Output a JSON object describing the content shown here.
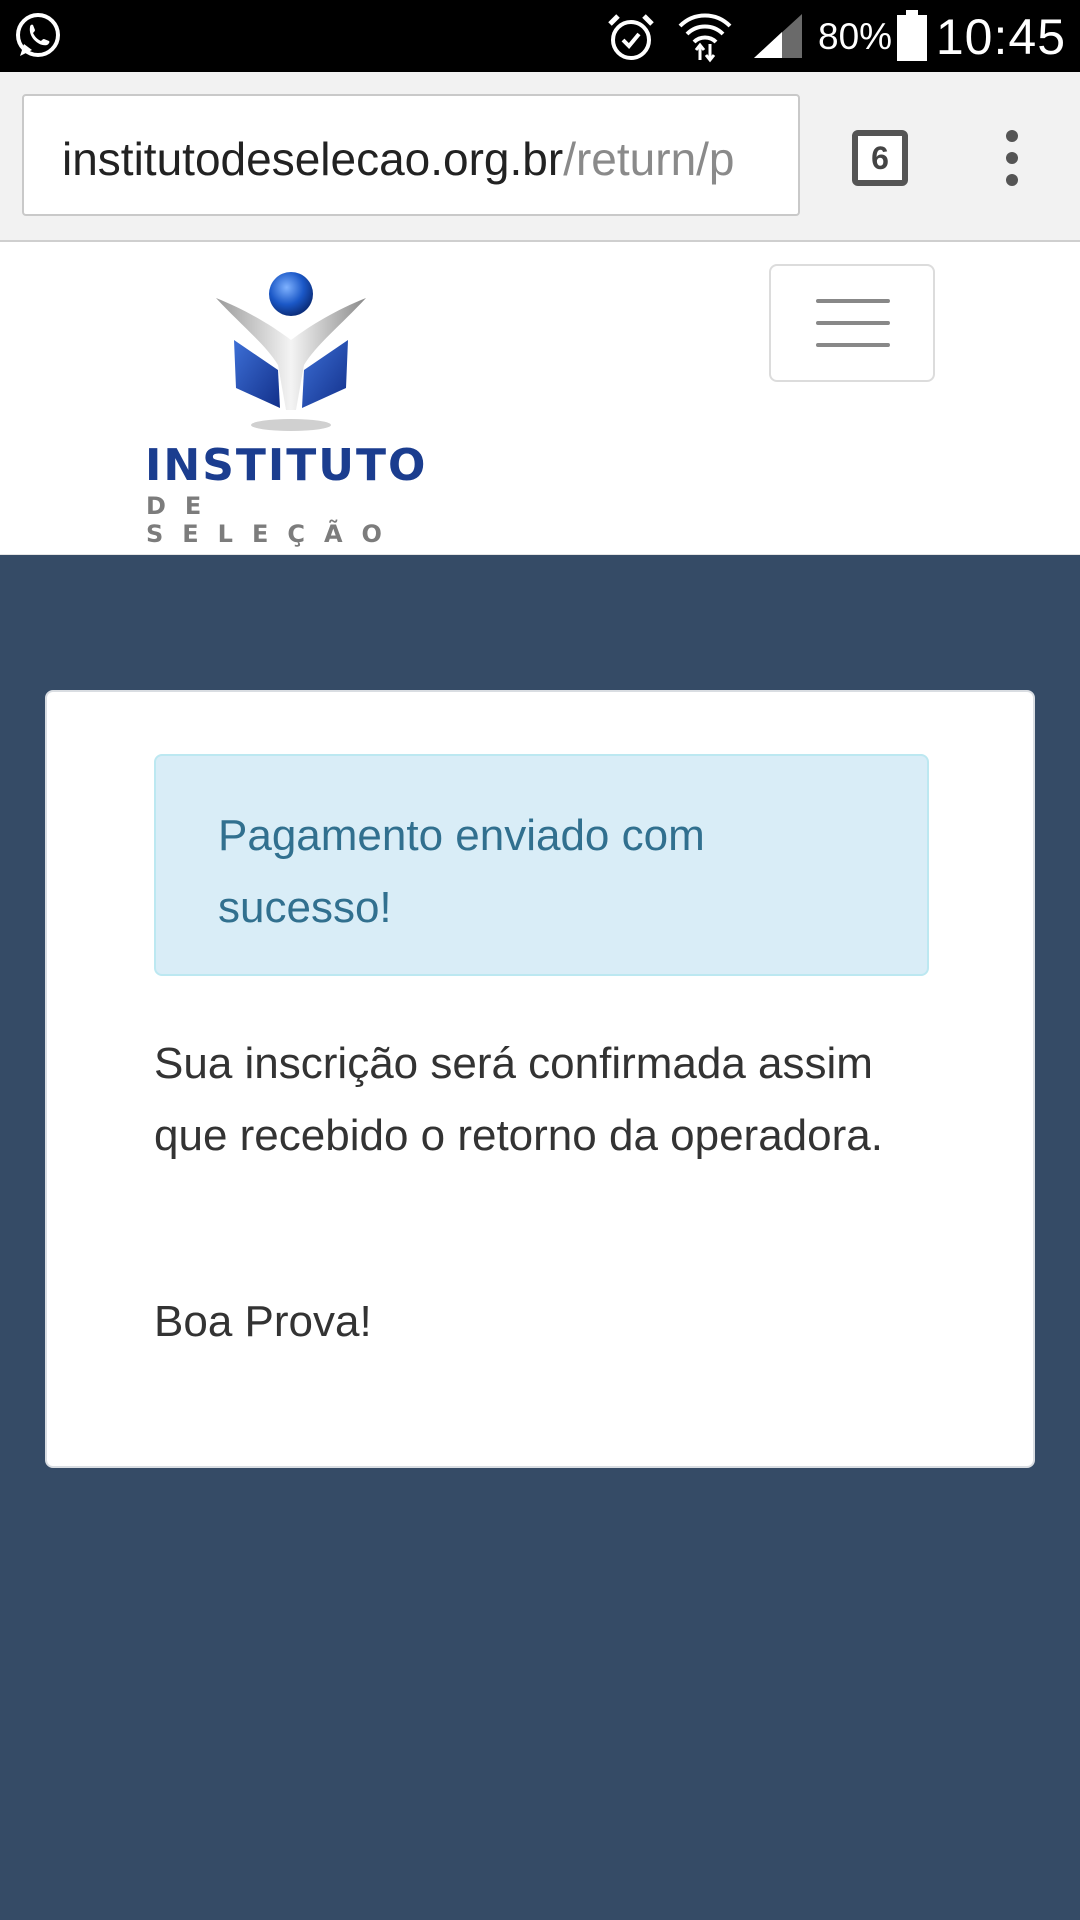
{
  "status_bar": {
    "battery_percent": "80%",
    "time": "10:45",
    "icons": [
      "whatsapp-icon",
      "alarm-icon",
      "wifi-icon",
      "signal-icon",
      "battery-icon"
    ]
  },
  "browser": {
    "url_host": "institutodeselecao.org.br",
    "url_path": "/return/p",
    "tab_count": "6"
  },
  "site": {
    "logo_title": "INSTITUTO",
    "logo_subtitle": "DE SELEÇÃO"
  },
  "card": {
    "alert_text": "Pagamento enviado com sucesso!",
    "message": "Sua inscrição será confirmada assim que recebido o retorno da operadora.",
    "closing": "Boa Prova!"
  },
  "colors": {
    "page_background": "#354b66",
    "alert_background": "#d9edf7",
    "alert_text": "#31708f",
    "logo_blue": "#1b3d8f"
  }
}
